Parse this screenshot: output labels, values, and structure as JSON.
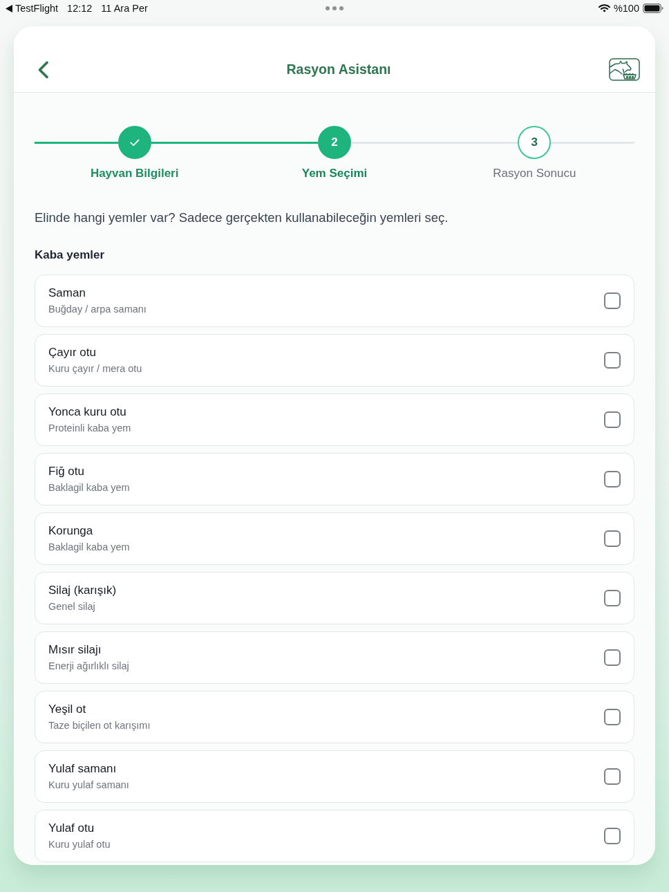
{
  "status_bar": {
    "back_app": "TestFlight",
    "time": "12:12",
    "date": "11 Ara Per",
    "battery": "%100"
  },
  "header": {
    "title": "Rasyon Asistanı"
  },
  "stepper": {
    "steps": [
      {
        "label": "Hayvan Bilgileri",
        "completed": true,
        "selected": false
      },
      {
        "number": "2",
        "label": "Yem Seçimi",
        "completed": false,
        "selected": true
      },
      {
        "number": "3",
        "label": "Rasyon Sonucu",
        "completed": false,
        "selected": false
      }
    ]
  },
  "prompt": "Elinde hangi yemler var? Sadece gerçekten kullanabileceğin yemleri seç.",
  "sections": [
    {
      "title": "Kaba yemler",
      "items": [
        {
          "name": "Saman",
          "description": "Buğday / arpa samanı",
          "checked": false
        },
        {
          "name": "Çayır otu",
          "description": "Kuru çayır / mera otu",
          "checked": false
        },
        {
          "name": "Yonca kuru otu",
          "description": "Proteinli kaba yem",
          "checked": false
        },
        {
          "name": "Fiğ otu",
          "description": "Baklagil kaba yem",
          "checked": false
        },
        {
          "name": "Korunga",
          "description": "Baklagil kaba yem",
          "checked": false
        },
        {
          "name": "Silaj (karışık)",
          "description": "Genel silaj",
          "checked": false
        },
        {
          "name": "Mısır silajı",
          "description": "Enerji ağırlıklı silaj",
          "checked": false
        },
        {
          "name": "Yeşil ot",
          "description": "Taze biçilen ot karışımı",
          "checked": false
        },
        {
          "name": "Yulaf samanı",
          "description": "Kuru yulaf samanı",
          "checked": false
        },
        {
          "name": "Yulaf otu",
          "description": "Kuru yulaf otu",
          "checked": false
        }
      ]
    }
  ]
}
